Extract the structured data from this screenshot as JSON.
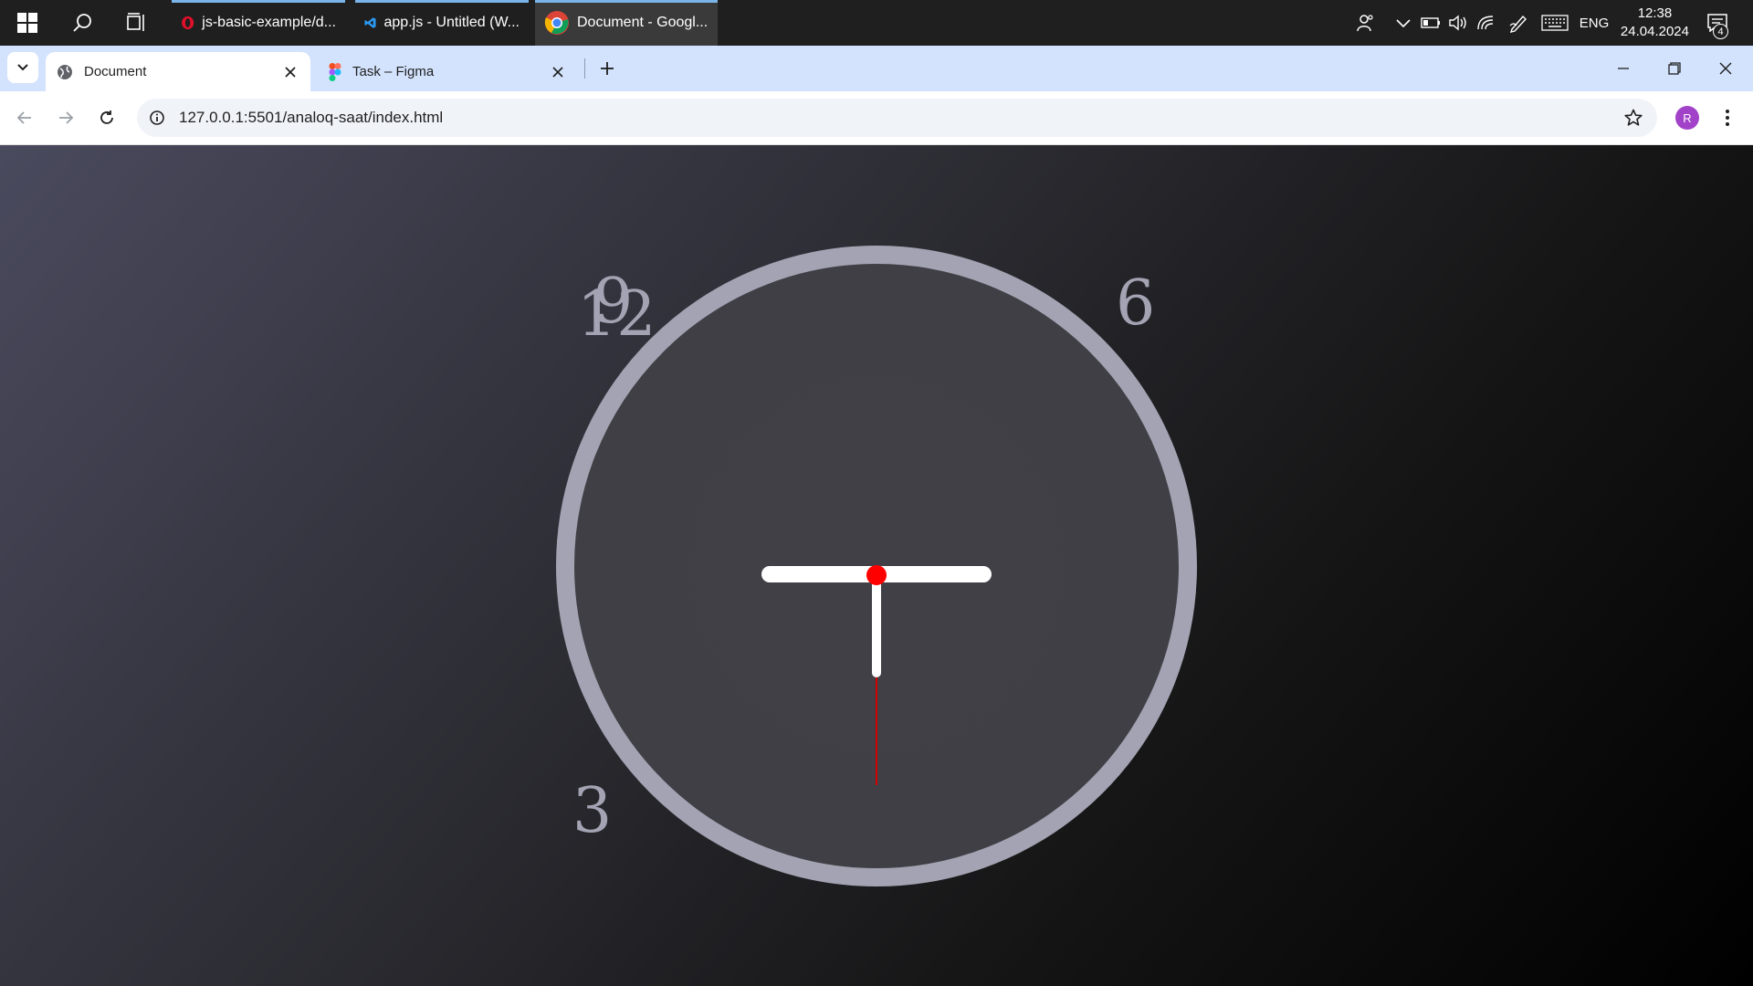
{
  "taskbar": {
    "apps": [
      {
        "label": "js-basic-example/d...",
        "icon": "opera-icon"
      },
      {
        "label": "app.js - Untitled (W...",
        "icon": "vscode-icon"
      },
      {
        "label": "Document - Googl...",
        "icon": "chrome-icon"
      }
    ],
    "tray": {
      "language": "ENG",
      "time": "12:38",
      "date": "24.04.2024",
      "notifications": "4"
    }
  },
  "browser": {
    "tabs": [
      {
        "title": "Document",
        "active": true
      },
      {
        "title": "Task – Figma",
        "active": false
      }
    ],
    "url": "127.0.0.1:5501/analoq-saat/index.html",
    "profile_initial": "R"
  },
  "clock": {
    "numbers": [
      "12",
      "9",
      "6",
      "3"
    ],
    "colors": {
      "ring": "#a3a3b3",
      "face": "#3f3f45",
      "hands": "#ffffff",
      "second_hand": "#d40000",
      "center": "#ff0000"
    }
  }
}
